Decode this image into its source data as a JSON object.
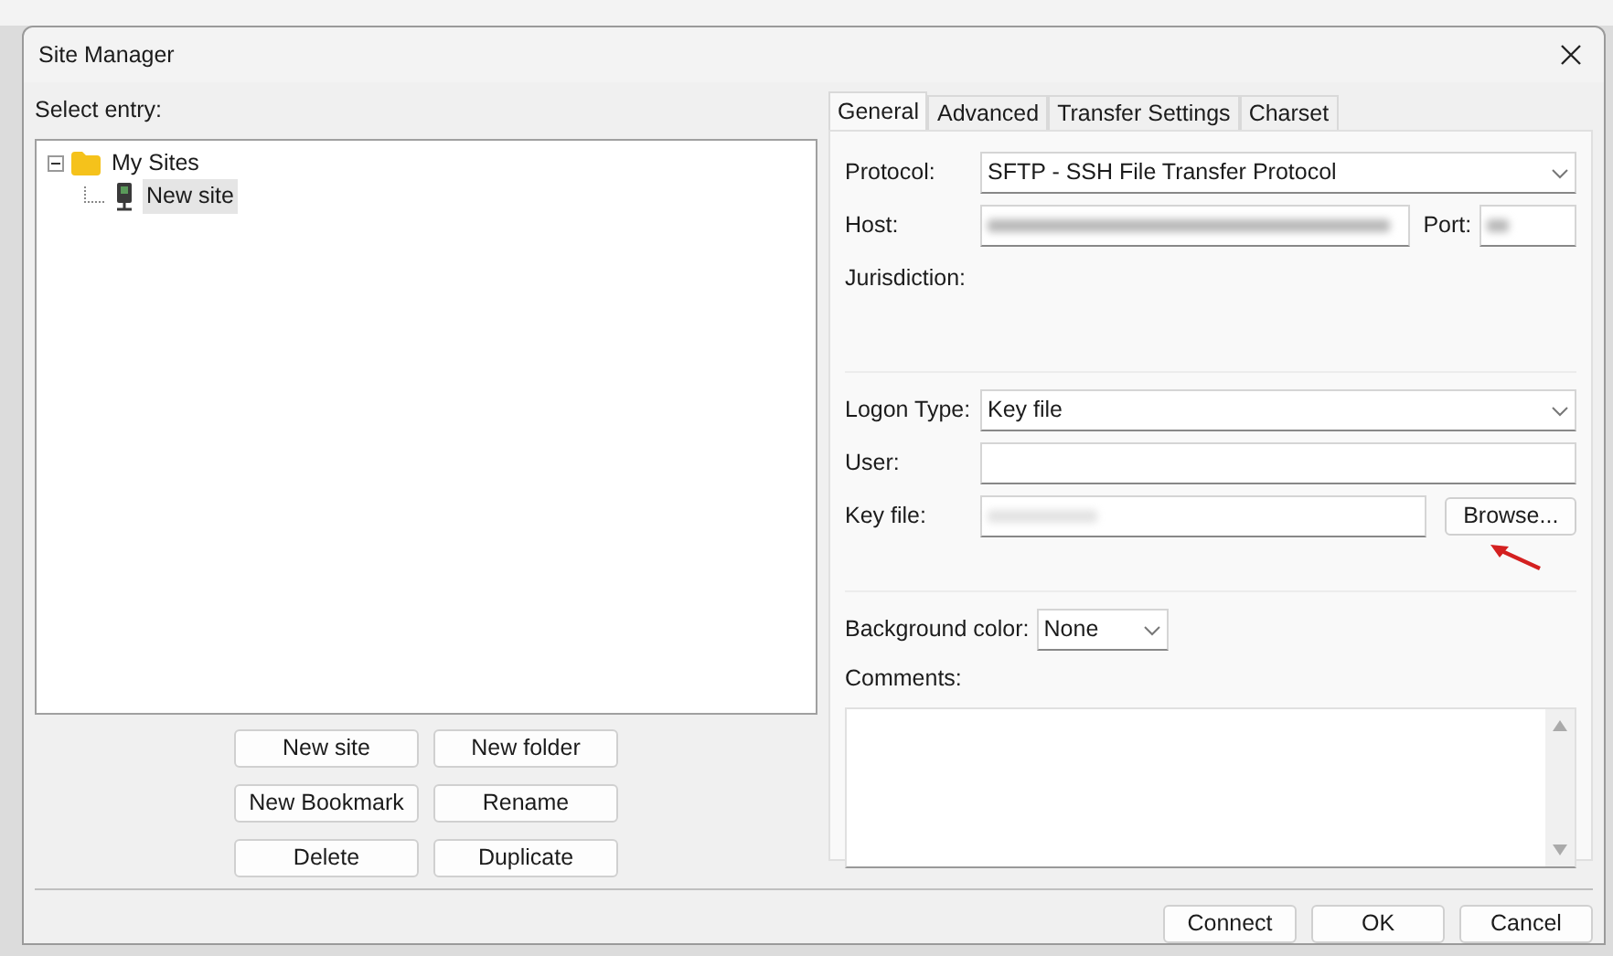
{
  "window": {
    "title": "Site Manager"
  },
  "site_tree": {
    "label": "Select entry:",
    "items": [
      {
        "label": "My Sites",
        "kind": "folder",
        "expanded": true,
        "selected": false,
        "children": [
          {
            "label": "New site",
            "kind": "site",
            "selected": true
          }
        ]
      }
    ]
  },
  "tree_buttons": [
    "New site",
    "New folder",
    "New Bookmark",
    "Rename",
    "Delete",
    "Duplicate"
  ],
  "tabs": [
    {
      "label": "General",
      "selected": true
    },
    {
      "label": "Advanced",
      "selected": false
    },
    {
      "label": "Transfer Settings",
      "selected": false
    },
    {
      "label": "Charset",
      "selected": false
    }
  ],
  "general": {
    "protocol_label": "Protocol:",
    "protocol": "SFTP - SSH File Transfer Protocol",
    "host_label": "Host:",
    "port_label": "Port:",
    "jurisdiction_label": "Jurisdiction:",
    "logon_type_label": "Logon Type:",
    "logon_type": "Key file",
    "user_label": "User:",
    "key_file_label": "Key file:",
    "browse_button": "Browse...",
    "background_color_label": "Background color:",
    "background_color": "None",
    "comments_label": "Comments:"
  },
  "footer_buttons": [
    "Connect",
    "OK",
    "Cancel"
  ]
}
